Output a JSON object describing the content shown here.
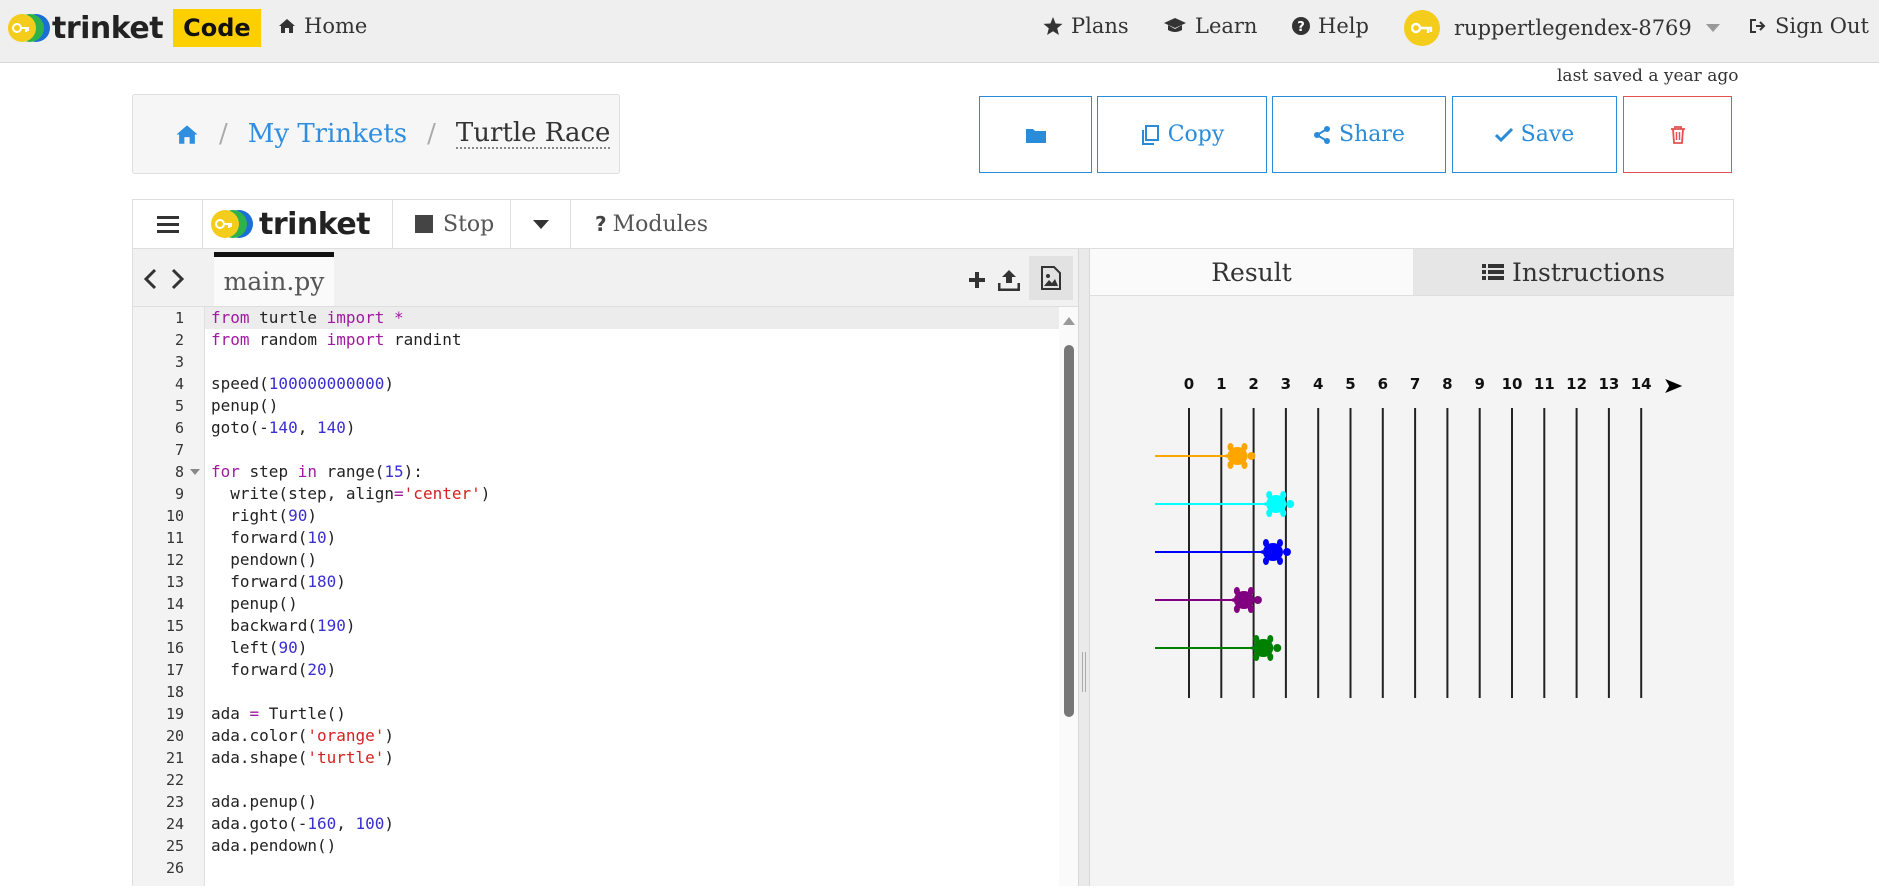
{
  "nav": {
    "brand": "trinket",
    "badge": "Code",
    "home": "Home",
    "plans": "Plans",
    "learn": "Learn",
    "help": "Help",
    "username": "ruppertlegendex-8769",
    "signout": "Sign Out"
  },
  "status": {
    "last_saved": "last saved a year ago"
  },
  "breadcrumb": {
    "my_trinkets": "My Trinkets",
    "title": "Turtle Race"
  },
  "actions": {
    "copy": "Copy",
    "share": "Share",
    "save": "Save"
  },
  "toolbar": {
    "brand": "trinket",
    "stop": "Stop",
    "modules": "Modules"
  },
  "editor": {
    "filename": "main.py",
    "lines": [
      "from turtle import *",
      "from random import randint",
      "",
      "speed(100000000000)",
      "penup()",
      "goto(-140, 140)",
      "",
      "for step in range(15):",
      "  write(step, align='center')",
      "  right(90)",
      "  forward(10)",
      "  pendown()",
      "  forward(180)",
      "  penup()",
      "  backward(190)",
      "  left(90)",
      "  forward(20)",
      "",
      "ada = Turtle()",
      "ada.color('orange')",
      "ada.shape('turtle')",
      "",
      "ada.penup()",
      "ada.goto(-160, 100)",
      "ada.pendown()",
      ""
    ]
  },
  "output": {
    "tab_result": "Result",
    "tab_instructions": "Instructions",
    "track_labels": [
      "0",
      "1",
      "2",
      "3",
      "4",
      "5",
      "6",
      "7",
      "8",
      "9",
      "10",
      "11",
      "12",
      "13",
      "14"
    ],
    "turtles": [
      {
        "color": "#ffa500",
        "position": 1.5
      },
      {
        "color": "#00ffff",
        "position": 2.7
      },
      {
        "color": "#0000ff",
        "position": 2.6
      },
      {
        "color": "#800080",
        "position": 1.7
      },
      {
        "color": "#008000",
        "position": 2.3
      }
    ]
  },
  "colors": {
    "accent": "#2a8bd8",
    "danger": "#e55050",
    "brand_yellow": "#fcd000"
  }
}
